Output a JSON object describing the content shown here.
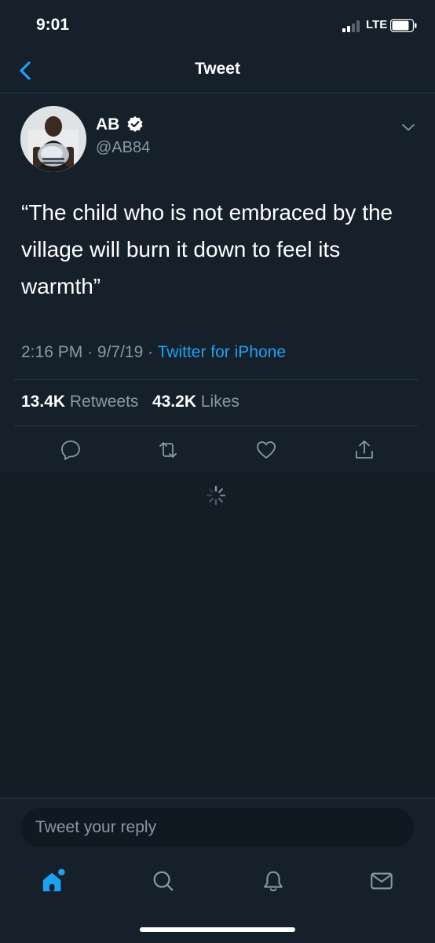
{
  "status_bar": {
    "time": "9:01",
    "network": "LTE"
  },
  "nav": {
    "title": "Tweet",
    "back_icon": "chevron-left-icon"
  },
  "tweet": {
    "display_name": "AB",
    "handle": "@AB84",
    "text": "“The child who is not embraced by the village will burn it down to feel its warmth”",
    "time": "2:16 PM",
    "date": "9/7/19",
    "separator": "·",
    "source": "Twitter for iPhone",
    "retweets_count": "13.4K",
    "retweets_label": "Retweets",
    "likes_count": "43.2K",
    "likes_label": "Likes"
  },
  "reply": {
    "placeholder": "Tweet your reply"
  },
  "colors": {
    "accent": "#1da1f2",
    "background": "#15202b",
    "secondary_text": "#8899a6"
  }
}
